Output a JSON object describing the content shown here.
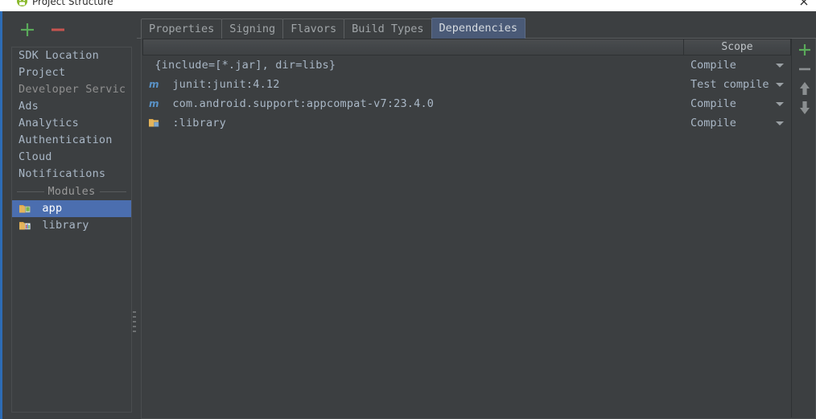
{
  "window": {
    "title": "Project Structure",
    "app_icon": "android-studio-icon",
    "close_icon": "close-icon"
  },
  "sidebar": {
    "toolbar": {
      "add_label": "+",
      "add_icon": "plus-icon",
      "remove_label": "−",
      "remove_icon": "minus-icon"
    },
    "items": [
      {
        "label": "SDK Location",
        "icon": "",
        "selected": false,
        "dim": false,
        "indent": 0
      },
      {
        "label": "Project",
        "icon": "",
        "selected": false,
        "dim": false,
        "indent": 0
      },
      {
        "label": "Developer Servic",
        "icon": "",
        "selected": false,
        "dim": true,
        "indent": 0
      },
      {
        "label": "Ads",
        "icon": "",
        "selected": false,
        "dim": false,
        "indent": 0
      },
      {
        "label": "Analytics",
        "icon": "",
        "selected": false,
        "dim": false,
        "indent": 0
      },
      {
        "label": "Authentication",
        "icon": "",
        "selected": false,
        "dim": false,
        "indent": 0
      },
      {
        "label": "Cloud",
        "icon": "",
        "selected": false,
        "dim": false,
        "indent": 0
      },
      {
        "label": "Notifications",
        "icon": "",
        "selected": false,
        "dim": false,
        "indent": 0
      }
    ],
    "separator_label": "Modules",
    "modules": [
      {
        "label": "app",
        "icon": "android-module-icon",
        "selected": true
      },
      {
        "label": "library",
        "icon": "library-module-icon",
        "selected": false
      }
    ]
  },
  "tabs": [
    {
      "label": "Properties",
      "active": false
    },
    {
      "label": "Signing",
      "active": false
    },
    {
      "label": "Flavors",
      "active": false
    },
    {
      "label": "Build Types",
      "active": false
    },
    {
      "label": "Dependencies",
      "active": true
    }
  ],
  "table": {
    "columns": [
      "",
      "Scope"
    ],
    "rows": [
      {
        "name": "{include=[*.jar], dir=libs}",
        "icon": "",
        "scope": "Compile"
      },
      {
        "name": "junit:junit:4.12",
        "icon": "maven-icon",
        "scope": "Test compile"
      },
      {
        "name": "com.android.support:appcompat-v7:23.4.0",
        "icon": "maven-icon",
        "scope": "Compile"
      },
      {
        "name": ":library",
        "icon": "module-icon",
        "scope": "Compile"
      }
    ]
  },
  "side_toolbar": [
    {
      "name": "add-dependency-button",
      "icon": "plus-icon"
    },
    {
      "name": "remove-dependency-button",
      "icon": "minus-icon"
    },
    {
      "name": "move-up-button",
      "icon": "arrow-up-icon"
    },
    {
      "name": "move-down-button",
      "icon": "arrow-down-icon"
    }
  ],
  "colors": {
    "background": "#3c3f41",
    "selection": "#4b6eaf",
    "active_tab": "#4a5a77",
    "accent_line": "#2d6cb5",
    "add_green": "#5aaa5a",
    "remove_red": "#c75450",
    "text": "#a9b7c6"
  }
}
